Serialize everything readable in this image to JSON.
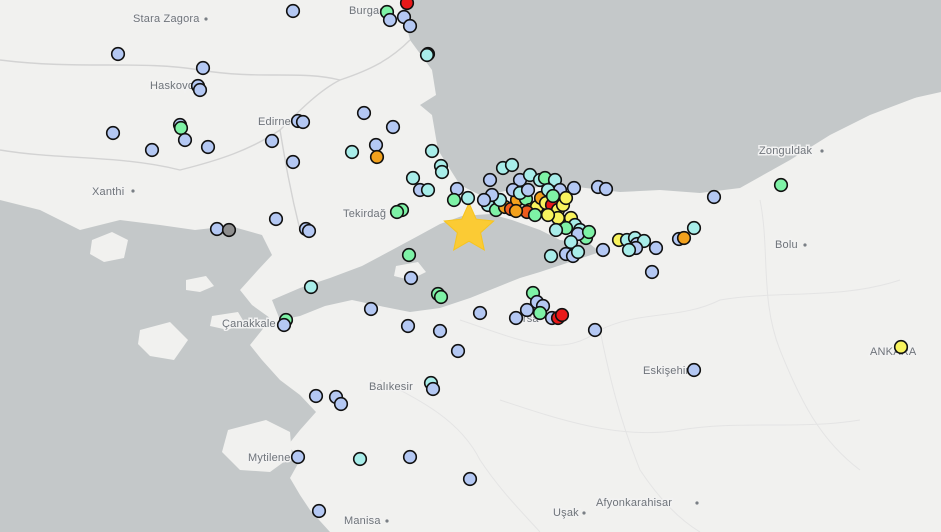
{
  "map": {
    "colors": {
      "sea": "#c4c8c9",
      "land": "#f1f1ef",
      "border": "#d6d6d6"
    },
    "epicenter_icon": "star-icon",
    "epicenter_color": "#fbcb34",
    "cities": [
      {
        "name": "Stara Zagora",
        "id": "stara-zagora"
      },
      {
        "name": "Burgas",
        "id": "burgas"
      },
      {
        "name": "Haskovo",
        "id": "haskovo"
      },
      {
        "name": "Edirne",
        "id": "edirne"
      },
      {
        "name": "Xanthi",
        "id": "xanthi"
      },
      {
        "name": "Tekirdağ",
        "id": "tekirdag"
      },
      {
        "name": "Zonguldak",
        "id": "zonguldak"
      },
      {
        "name": "Bolu",
        "id": "bolu"
      },
      {
        "name": "Çanakkale",
        "id": "canakkale"
      },
      {
        "name": "Bursa",
        "id": "bursa"
      },
      {
        "name": "Eskişehir",
        "id": "eskisehir"
      },
      {
        "name": "ANKARA",
        "id": "ankara"
      },
      {
        "name": "Balıkesir",
        "id": "balikesir"
      },
      {
        "name": "Mytilene",
        "id": "mytilene"
      },
      {
        "name": "Afyonkarahisar",
        "id": "afyonkarahisar"
      },
      {
        "name": "Manisa",
        "id": "manisa"
      },
      {
        "name": "Uşak",
        "id": "usak"
      }
    ],
    "intensity_colors": {
      "i1": "#b4c8f3",
      "i2": "#a8ede9",
      "i3": "#7ef2a6",
      "i4": "#f8f35e",
      "i5": "#f2a11d",
      "i6": "#ef5b1e",
      "i7": "#e81919",
      "none": "#8e8e8e"
    }
  }
}
